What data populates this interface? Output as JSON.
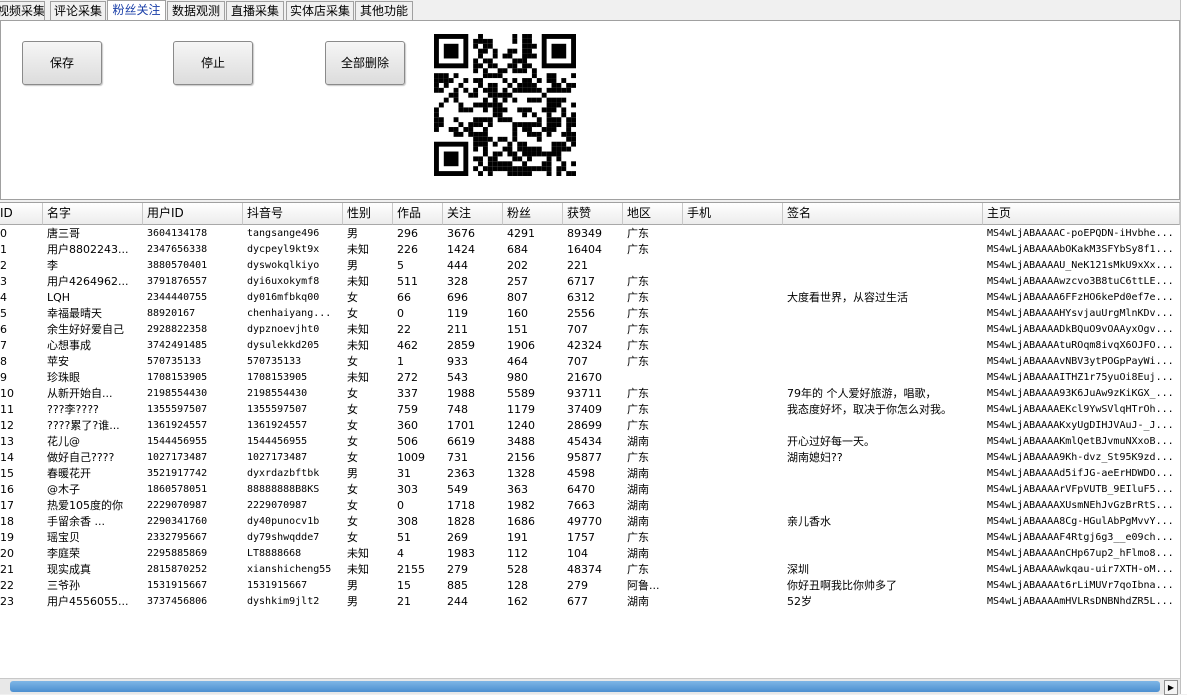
{
  "tabs": [
    {
      "label": "视频采集",
      "active": false
    },
    {
      "label": "评论采集",
      "active": false
    },
    {
      "label": "粉丝关注",
      "active": true
    },
    {
      "label": "数据观测",
      "active": false
    },
    {
      "label": "直播采集",
      "active": false
    },
    {
      "label": "实体店采集",
      "active": false
    },
    {
      "label": "其他功能",
      "active": false
    }
  ],
  "toolbar": {
    "save_label": "保存",
    "stop_label": "停止",
    "delete_all_label": "全部删除"
  },
  "qr_icon": "qr-code",
  "table": {
    "columns": [
      "ID",
      "名字",
      "用户ID",
      "抖音号",
      "性别",
      "作品",
      "关注",
      "粉丝",
      "获赞",
      "地区",
      "手机",
      "签名",
      "主页"
    ],
    "rows": [
      [
        "0",
        "唐三哥",
        "3604134178",
        "tangsange496",
        "男",
        "296",
        "3676",
        "4291",
        "89349",
        "广东",
        "",
        "",
        "MS4wLjABAAAAC-poEPQDN-iHvbhe..."
      ],
      [
        "1",
        "用户8802243...",
        "2347656338",
        "dycpeyl9kt9x",
        "未知",
        "226",
        "1424",
        "684",
        "16404",
        "广东",
        "",
        "",
        "MS4wLjABAAAAbOKakM3SFYbSy8f1..."
      ],
      [
        "2",
        "李",
        "3880570401",
        "dyswokqlkiyo",
        "男",
        "5",
        "444",
        "202",
        "221",
        "",
        "",
        "",
        "MS4wLjABAAAAU_NeK121sMkU9xXx..."
      ],
      [
        "3",
        "用户4264962...",
        "3791876557",
        "dyi6uxokymf8",
        "未知",
        "511",
        "328",
        "257",
        "6717",
        "广东",
        "",
        "",
        "MS4wLjABAAAAwzcvo3B8tuC6ttLE..."
      ],
      [
        "4",
        "LQH",
        "2344440755",
        "dy016mfbkq00",
        "女",
        "66",
        "696",
        "807",
        "6312",
        "广东",
        "",
        "大度看世界，从容过生活",
        "MS4wLjABAAAA6FFzHO6kePd0ef7e..."
      ],
      [
        "5",
        "幸福最晴天",
        "88920167",
        "chenhaiyang...",
        "女",
        "0",
        "119",
        "160",
        "2556",
        "广东",
        "",
        "",
        "MS4wLjABAAAAHYsvjauUrgMlnKDv..."
      ],
      [
        "6",
        "余生好好爱自己",
        "2928822358",
        "dypznoevjht0",
        "未知",
        "22",
        "211",
        "151",
        "707",
        "广东",
        "",
        "",
        "MS4wLjABAAAADkBQuO9vOAAyxOgv..."
      ],
      [
        "7",
        "心想事成",
        "3742491485",
        "dysulekkd205",
        "未知",
        "462",
        "2859",
        "1906",
        "42324",
        "广东",
        "",
        "",
        "MS4wLjABAAAAtuROqm8ivqX6OJFO..."
      ],
      [
        "8",
        "苹安",
        "570735133",
        "570735133",
        "女",
        "1",
        "933",
        "464",
        "707",
        "广东",
        "",
        "",
        "MS4wLjABAAAAvNBV3ytPOGpPayWi..."
      ],
      [
        "9",
        "珍珠眼",
        "1708153905",
        "1708153905",
        "未知",
        "272",
        "543",
        "980",
        "21670",
        "",
        "",
        "",
        "MS4wLjABAAAAITHZ1r75yuOi8Euj..."
      ],
      [
        "10",
        "从新开始自...",
        "2198554430",
        "2198554430",
        "女",
        "337",
        "1988",
        "5589",
        "93711",
        "广东",
        "",
        "79年的 个人爱好旅游，唱歌，",
        "MS4wLjABAAAA93K6JuAw9zKiKGX_..."
      ],
      [
        "11",
        "???李????",
        "1355597507",
        "1355597507",
        "女",
        "759",
        "748",
        "1179",
        "37409",
        "广东",
        "",
        "我态度好坏，取决于你怎么对我。",
        "MS4wLjABAAAAEKcl9YwSVlqHTrOh..."
      ],
      [
        "12",
        "????累了?谁...",
        "1361924557",
        "1361924557",
        "女",
        "360",
        "1701",
        "1240",
        "28699",
        "广东",
        "",
        "",
        "MS4wLjABAAAAKxyUgDIHJVAuJ-_J..."
      ],
      [
        "13",
        "花儿@",
        "1544456955",
        "1544456955",
        "女",
        "506",
        "6619",
        "3488",
        "45434",
        "湖南",
        "",
        "开心过好每一天。",
        "MS4wLjABAAAAKmlQetBJvmuNXxoB..."
      ],
      [
        "14",
        "做好自己????",
        "1027173487",
        "1027173487",
        "女",
        "1009",
        "731",
        "2156",
        "95877",
        "广东",
        "",
        "湖南媳妇??",
        "MS4wLjABAAAA9Kh-dvz_St95K9zd..."
      ],
      [
        "15",
        "春暖花开",
        "3521917742",
        "dyxrdazbftbk",
        "男",
        "31",
        "2363",
        "1328",
        "4598",
        "湖南",
        "",
        "",
        "MS4wLjABAAAAd5ifJG-aeErHDWDO..."
      ],
      [
        "16",
        "@木子",
        "1860578051",
        "88888888B8KS",
        "女",
        "303",
        "549",
        "363",
        "6470",
        "湖南",
        "",
        "",
        "MS4wLjABAAAArVFpVUTB_9EIluF5..."
      ],
      [
        "17",
        "热爱105度的你",
        "2229070987",
        "2229070987",
        "女",
        "0",
        "1718",
        "1982",
        "7663",
        "湖南",
        "",
        "",
        "MS4wLjABAAAAXUsmNEhJvGzBrRtS..."
      ],
      [
        "18",
        "手留余香  ...",
        "2290341760",
        "dy40punocv1b",
        "女",
        "308",
        "1828",
        "1686",
        "49770",
        "湖南",
        "",
        "亲儿香水",
        "MS4wLjABAAAA8Cg-HGulAbPgMvvY..."
      ],
      [
        "19",
        "瑶宝贝",
        "2332795667",
        "dy79shwqdde7",
        "女",
        "51",
        "269",
        "191",
        "1757",
        "广东",
        "",
        "",
        "MS4wLjABAAAAF4Rtgj6g3__e09ch..."
      ],
      [
        "20",
        "李庭荣",
        "2295885869",
        "LT8888668",
        "未知",
        "4",
        "1983",
        "112",
        "104",
        "湖南",
        "",
        "",
        "MS4wLjABAAAAnCHp67up2_hFlmo8..."
      ],
      [
        "21",
        "现实成真",
        "2815870252",
        "xianshicheng55",
        "未知",
        "2155",
        "279",
        "528",
        "48374",
        "广东",
        "",
        "深圳",
        "MS4wLjABAAAAwkqau-uir7XTH-oM..."
      ],
      [
        "22",
        "三爷孙",
        "1531915667",
        "1531915667",
        "男",
        "15",
        "885",
        "128",
        "279",
        "阿鲁...",
        "",
        "你好丑啊我比你帅多了",
        "MS4wLjABAAAAt6rLiMUVr7qoIbna..."
      ],
      [
        "23",
        "用户4556055...",
        "3737456806",
        "dyshkim9jlt2",
        "男",
        "21",
        "244",
        "162",
        "677",
        "湖南",
        "",
        "52岁",
        "MS4wLjABAAAAmHVLRsDNBNhdZR5L..."
      ]
    ]
  }
}
